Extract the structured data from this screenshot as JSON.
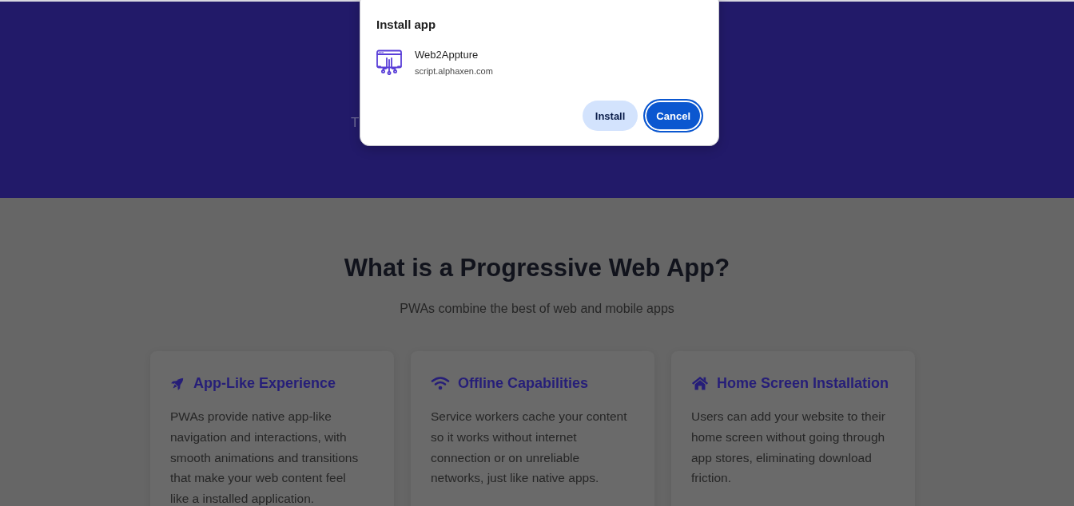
{
  "hero": {
    "subtitle": "T"
  },
  "install_dialog": {
    "title": "Install app",
    "app_name": "Web2Appture",
    "origin": "script.alphaxen.com",
    "buttons": [
      {
        "label": "Install",
        "kind": "secondary",
        "focused": false
      },
      {
        "label": "Cancel",
        "kind": "primary",
        "focused": true
      }
    ]
  },
  "intro": {
    "title": "What is a Progressive Web App?",
    "subtitle": "PWAs combine the best of web and mobile apps",
    "features": [
      {
        "title": "App-Like Experience",
        "description": "PWAs provide native app-like navigation and interactions, with smooth animations and transitions that make your web content feel like a installed application."
      },
      {
        "title": "Offline Capabilities",
        "description": "Service workers cache your content so it works without internet connection or on unreliable networks, just like native apps."
      },
      {
        "title": "Home Screen Installation",
        "description": "Users can add your website to their home screen without going through app stores, eliminating download friction."
      }
    ]
  }
}
